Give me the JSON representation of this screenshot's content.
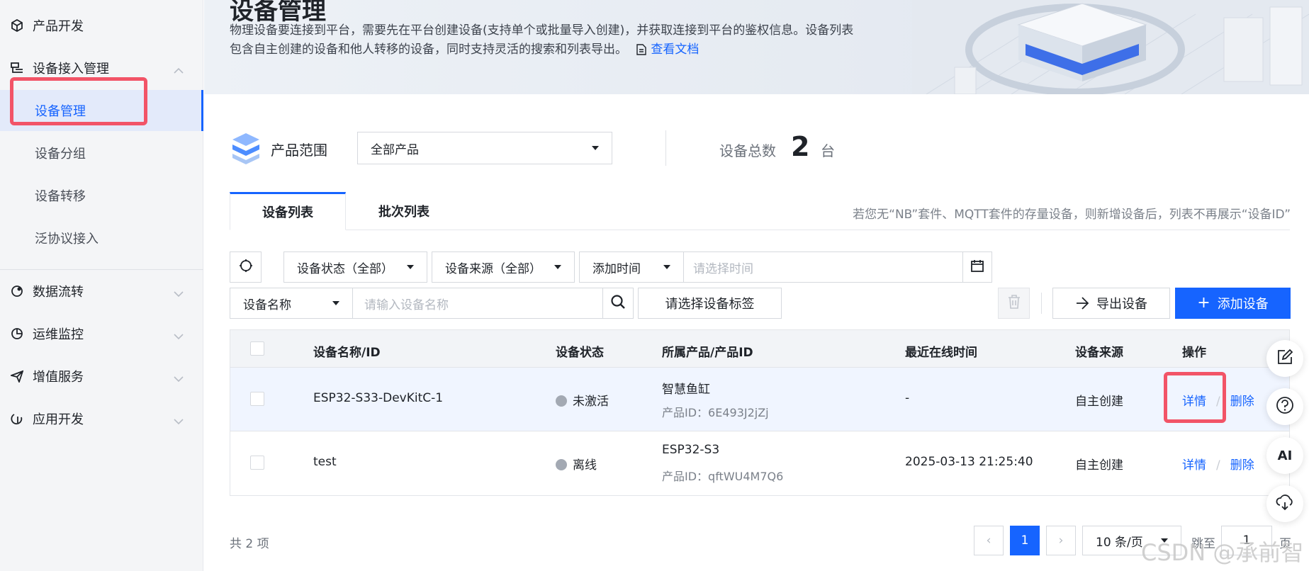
{
  "sidebar": {
    "items": [
      {
        "label": "产品开发",
        "icon": "cube-icon"
      },
      {
        "label": "设备接入管理",
        "icon": "device-access-icon"
      },
      {
        "label": "数据流转",
        "icon": "data-flow-icon"
      },
      {
        "label": "运维监控",
        "icon": "monitor-icon"
      },
      {
        "label": "增值服务",
        "icon": "plane-icon"
      },
      {
        "label": "应用开发",
        "icon": "app-dev-icon"
      }
    ],
    "sub_items": [
      {
        "label": "设备管理"
      },
      {
        "label": "设备分组"
      },
      {
        "label": "设备转移"
      },
      {
        "label": "泛协议接入"
      }
    ]
  },
  "banner": {
    "title": "设备管理",
    "desc_line1": "物理设备要连接到平台，需要先在平台创建设备(支持单个或批量导入创建)，并获取连接到平台的鉴权信息。设备列表",
    "desc_line2": "包含自主创建的设备和他人转移的设备，同时支持灵活的搜索和列表导出。",
    "doc_link": "查看文档"
  },
  "range": {
    "label": "产品范围",
    "select_value": "全部产品",
    "total_label": "设备总数",
    "total_value": "2",
    "total_unit": "台"
  },
  "tabs": [
    {
      "label": "设备列表",
      "active": true
    },
    {
      "label": "批次列表",
      "active": false
    }
  ],
  "tab_hint": "若您无“NB”套件、MQTT套件的存量设备，则新增设备后，列表不再展示“设备ID”",
  "filters": {
    "status": "设备状态（全部）",
    "source": "设备来源（全部）",
    "time_field": "添加时间",
    "time_placeholder": "请选择时间",
    "name_field": "设备名称",
    "name_placeholder": "请输入设备名称",
    "tag_button": "请选择设备标签",
    "export_button": "导出设备",
    "add_button": "添加设备"
  },
  "table": {
    "headers": [
      "设备名称/ID",
      "设备状态",
      "所属产品/产品ID",
      "最近在线时间",
      "设备来源",
      "操作"
    ],
    "rows": [
      {
        "name": "ESP32-S33-DevKitC-1",
        "status": "未激活",
        "product": "智慧鱼缸",
        "product_id": "产品ID：6E493J2jZj",
        "last_online": "-",
        "source": "自主创建",
        "detail": "详情",
        "delete": "删除"
      },
      {
        "name": "test",
        "status": "离线",
        "product": "ESP32-S3",
        "product_id": "产品ID：qftWU4M7Q6",
        "last_online": "2025-03-13 21:25:40",
        "source": "自主创建",
        "detail": "详情",
        "delete": "删除"
      }
    ]
  },
  "pagination": {
    "total": "共 2 项",
    "prev": "‹",
    "current": "1",
    "next": "›",
    "page_size": "10 条/页",
    "jump_label": "跳至",
    "jump_value": "1",
    "jump_unit": "页"
  },
  "float_tools": {
    "ai_label": "AI"
  },
  "watermark": "CSDN @承前智",
  "colors": {
    "primary": "#1664ff",
    "highlight": "#f25467"
  }
}
